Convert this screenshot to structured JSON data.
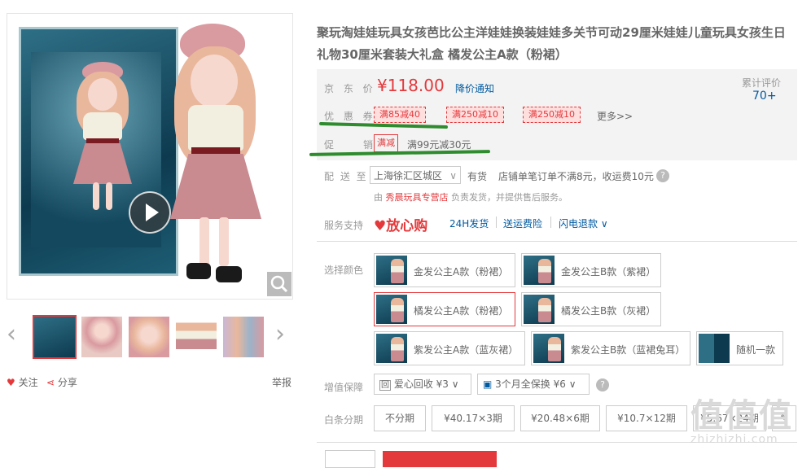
{
  "title": "聚玩淘娃娃玩具女孩芭比公主洋娃娃换装娃娃多关节可动29厘米娃娃儿童玩具女孩生日礼物30厘米套装大礼盒 橘发公主A款（粉裙）",
  "gallery": {
    "thumbs_count": 5,
    "selected_index": 0,
    "follow_label": "关注",
    "share_label": "分享",
    "report_label": "举报"
  },
  "summary": {
    "price_label": "京 东 价",
    "price": "¥118.00",
    "price_notice": "降价通知",
    "cum_label": "累计评价",
    "cum_count": "70+",
    "coupon_label": "优 惠 券",
    "coupons": [
      "满85减40",
      "满250减10",
      "满250减10"
    ],
    "more": "更多>>",
    "promo_label": "促　　销",
    "promo_tag": "满减",
    "promo_text": "满99元减30元"
  },
  "delivery": {
    "label": "配 送 至",
    "region": "上海徐汇区城区",
    "stock": "有货",
    "shipping": "店铺单笔订单不满8元，收运费10元",
    "seller_prefix": "由",
    "seller_name": "秀晨玩具专营店",
    "seller_suffix": "负责发货，并提供售后服务。"
  },
  "service": {
    "label": "服务支持",
    "logo": "♥放心购",
    "items": [
      "24H发货",
      "送运费险",
      "闪电退款 ∨"
    ]
  },
  "colors": {
    "label": "选择颜色",
    "options": [
      "金发公主A款（粉裙）",
      "金发公主B款（紫裙）",
      "橘发公主A款（粉裙）",
      "橘发公主B款（灰裙）",
      "紫发公主A款（蓝灰裙）",
      "紫发公主B款（蓝裙兔耳）",
      "随机一款"
    ],
    "selected_index": 2
  },
  "addons": {
    "label": "增值保障",
    "items": [
      "爱心回收 ¥3 ∨",
      "3个月全保换 ¥6 ∨"
    ]
  },
  "installments": {
    "label": "白条分期",
    "plans": [
      "不分期",
      "¥40.17×3期",
      "¥20.48×6期",
      "¥10.7×12期",
      "¥5.67×24期"
    ]
  },
  "watermark": {
    "text": "值值值",
    "url": "zhizhizhi.com"
  },
  "theme": {
    "accent": "#e4393c",
    "link": "#005aa0",
    "highlight_green": "#2e8b2e"
  }
}
